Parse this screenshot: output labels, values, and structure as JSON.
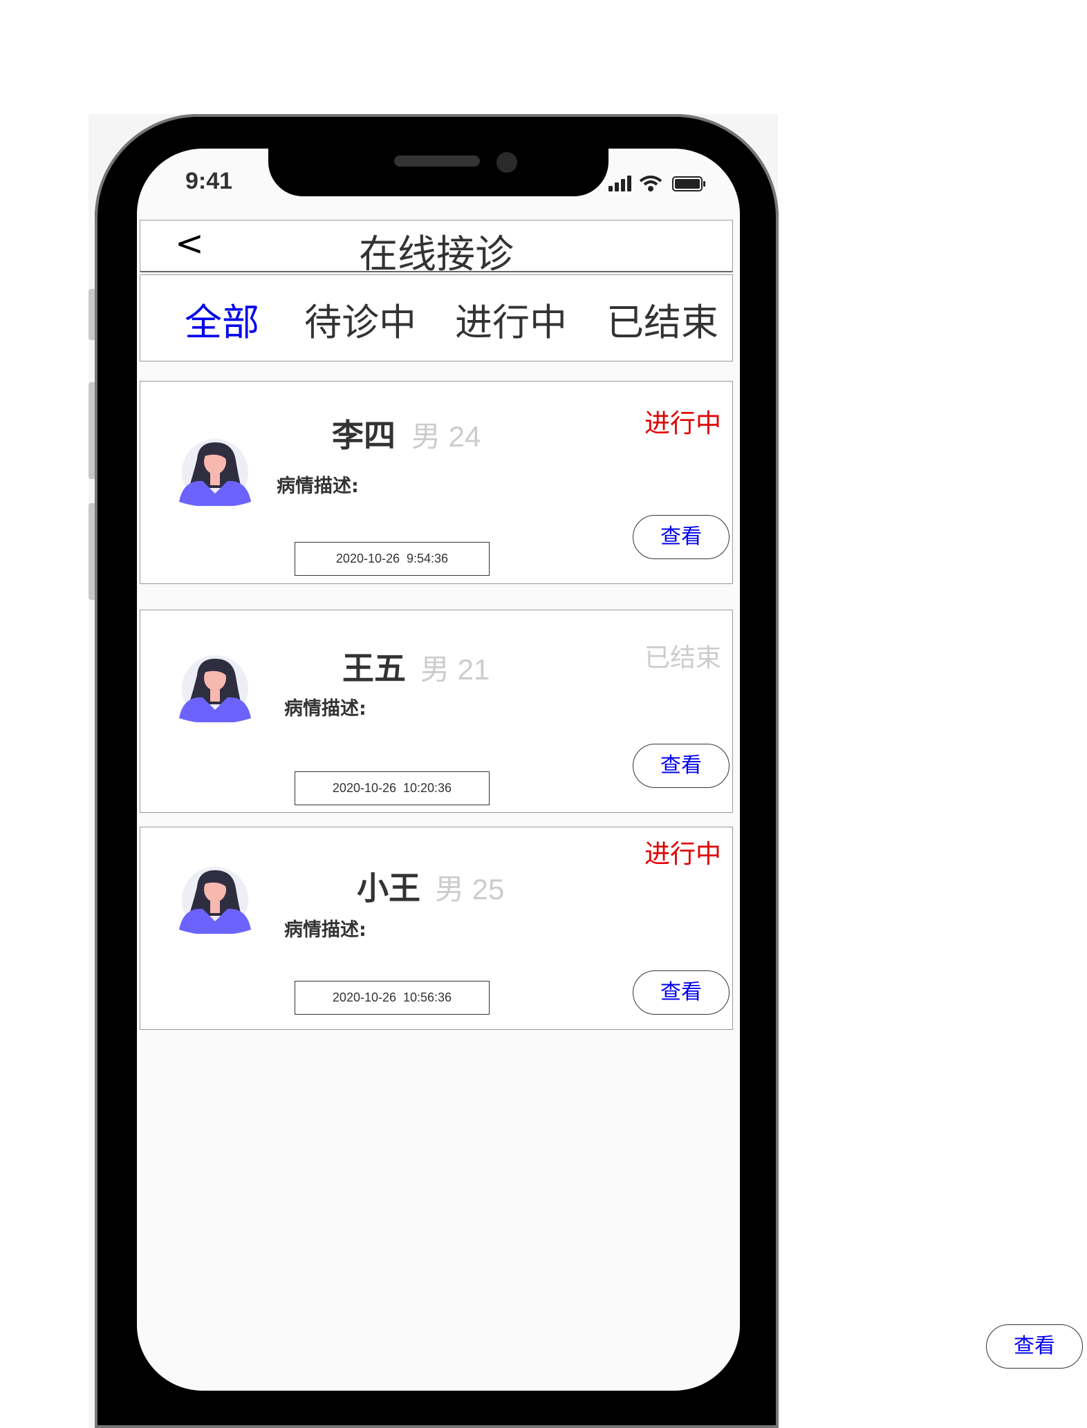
{
  "status_bar": {
    "time": "9:41"
  },
  "header": {
    "back": "<",
    "title": "在线接诊"
  },
  "tabs": [
    {
      "label": "全部",
      "active": true
    },
    {
      "label": "待诊中",
      "active": false
    },
    {
      "label": "进行中",
      "active": false
    },
    {
      "label": "已结束",
      "active": false
    }
  ],
  "cards": [
    {
      "name": "李四",
      "meta": "男 24",
      "desc_label": "病情描述:",
      "status": "进行中",
      "status_color": "#e00000",
      "time": "2020-10-26  9:54:36",
      "view": "查看"
    },
    {
      "name": "王五",
      "meta": "男 21",
      "desc_label": "病情描述:",
      "status": "已结束",
      "status_color": "#cccccc",
      "time": "2020-10-26  10:20:36",
      "view": "查看"
    },
    {
      "name": "小王",
      "meta": "男 25",
      "desc_label": "病情描述:",
      "status": "进行中",
      "status_color": "#e00000",
      "time": "2020-10-26  10:56:36",
      "view": "查看"
    }
  ],
  "extra_button": {
    "label": "查看"
  },
  "colors": {
    "accent": "#0000ee",
    "ongoing": "#e00000",
    "ended": "#cccccc",
    "avatar_shirt": "#6c63ff"
  }
}
